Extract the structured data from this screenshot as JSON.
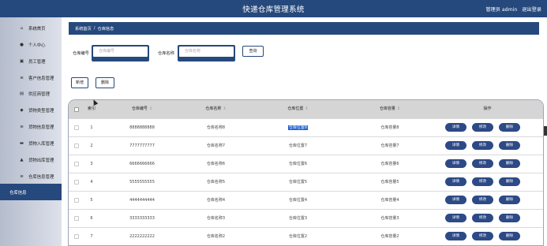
{
  "app": {
    "title": "快递仓库管理系统",
    "user_label": "管理员 admin",
    "logout_label": "退出登录"
  },
  "sidebar": {
    "items": [
      {
        "label": "系统首页",
        "icon": "home-icon",
        "glyph": "⌂"
      },
      {
        "label": "个人中心",
        "icon": "user-icon",
        "glyph": "●"
      },
      {
        "label": "员工管理",
        "icon": "id-card-icon",
        "glyph": "▣"
      },
      {
        "label": "客户信息管理",
        "icon": "list-icon",
        "glyph": "≡"
      },
      {
        "label": "供应商管理",
        "icon": "briefcase-icon",
        "glyph": "▤"
      },
      {
        "label": "货物类型管理",
        "icon": "shield-icon",
        "glyph": "◆"
      },
      {
        "label": "货物信息管理",
        "icon": "list-icon",
        "glyph": "≡"
      },
      {
        "label": "货物入库管理",
        "icon": "video-icon",
        "glyph": "▬"
      },
      {
        "label": "货物出库管理",
        "icon": "person-icon",
        "glyph": "▲"
      },
      {
        "label": "仓库信息管理",
        "icon": "list-icon",
        "glyph": "≡"
      },
      {
        "label": "仓库信息",
        "icon": "",
        "glyph": "",
        "active": true
      }
    ]
  },
  "breadcrumb": {
    "home": "系统首页",
    "separator": "/",
    "current": "仓库信息"
  },
  "search": {
    "code_label": "仓库编号",
    "code_placeholder": "仓库编号",
    "name_label": "仓库名称",
    "name_placeholder": "仓库名称",
    "query_label": "查询"
  },
  "toolbar": {
    "add_label": "新增",
    "delete_label": "删除"
  },
  "table": {
    "columns": [
      "索引",
      "仓库编号",
      "仓库名称",
      "仓库位置",
      "仓库容量",
      "操作"
    ],
    "sort_glyph": "↕",
    "rows": [
      {
        "index": "1",
        "code": "8888888888",
        "name": "仓库名称8",
        "location": "仓库位置8",
        "capacity": "仓库容量8",
        "location_selected": true
      },
      {
        "index": "2",
        "code": "7777777777",
        "name": "仓库名称7",
        "location": "仓库位置7",
        "capacity": "仓库容量7"
      },
      {
        "index": "3",
        "code": "6666666666",
        "name": "仓库名称6",
        "location": "仓库位置6",
        "capacity": "仓库容量6"
      },
      {
        "index": "4",
        "code": "5555555555",
        "name": "仓库名称5",
        "location": "仓库位置5",
        "capacity": "仓库容量5"
      },
      {
        "index": "5",
        "code": "4444444444",
        "name": "仓库名称4",
        "location": "仓库位置4",
        "capacity": "仓库容量4"
      },
      {
        "index": "6",
        "code": "3333333333",
        "name": "仓库名称3",
        "location": "仓库位置3",
        "capacity": "仓库容量3"
      },
      {
        "index": "7",
        "code": "2222222222",
        "name": "仓库名称2",
        "location": "仓库位置2",
        "capacity": "仓库容量2"
      }
    ],
    "actions": {
      "detail": "详情",
      "edit": "修改",
      "delete": "删除"
    }
  },
  "colors": {
    "primary": "#26497d",
    "action_button": "#2d4a86",
    "selection": "#1f5fd1"
  }
}
